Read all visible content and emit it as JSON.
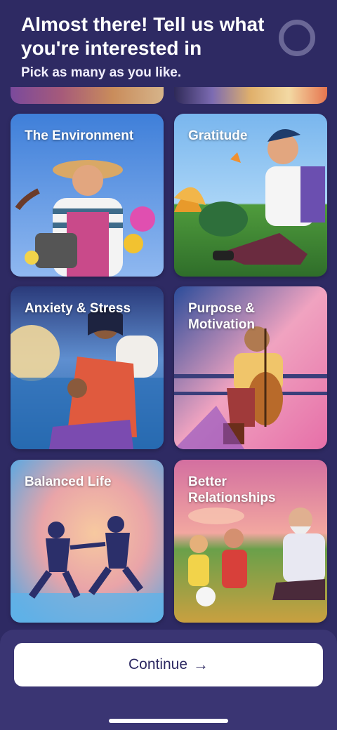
{
  "header": {
    "title": "Almost there! Tell us what you're interested in",
    "subtitle": "Pick as many as you like."
  },
  "topics": [
    {
      "label": "The Environment"
    },
    {
      "label": "Gratitude"
    },
    {
      "label": "Anxiety & Stress"
    },
    {
      "label": "Purpose & Motivation"
    },
    {
      "label": "Balanced Life"
    },
    {
      "label": "Better Relationships"
    }
  ],
  "footer": {
    "continue_label": "Continue",
    "continue_icon": "arrow-right-icon"
  },
  "colors": {
    "background": "#2e2a63",
    "footer": "#3a3573",
    "button": "#ffffff",
    "button_text": "#2e2a63"
  }
}
